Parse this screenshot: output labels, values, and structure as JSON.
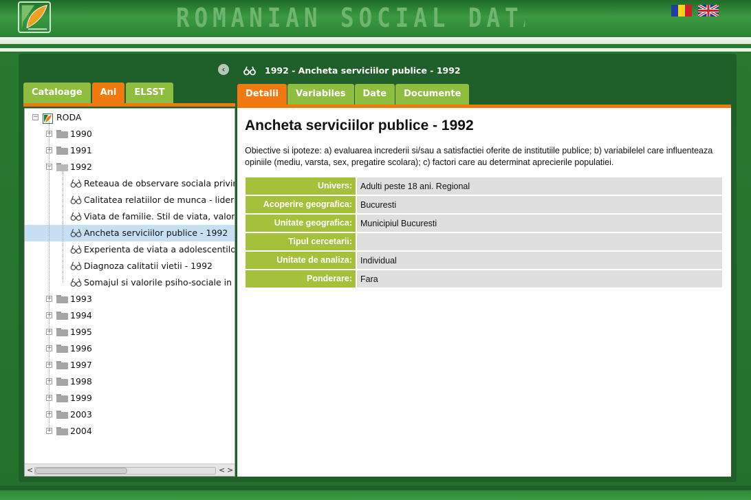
{
  "banner": {
    "title": "ROMANIAN SOCIAL DATA ARCHIVE",
    "logo_icon": "roda-logo-icon",
    "flags": [
      "romanian-flag-icon",
      "uk-flag-icon"
    ]
  },
  "left_panel": {
    "tabs": [
      {
        "label": "Cataloage",
        "active": false
      },
      {
        "label": "Ani",
        "active": true
      },
      {
        "label": "ELSST",
        "active": false
      }
    ],
    "tree": {
      "root": "RODA",
      "years_before": [
        "1990",
        "1991"
      ],
      "open_year": "1992",
      "studies": [
        "Reteaua de observare sociala privind",
        "Calitatea relatiilor de munca - lideri sir",
        "Viata de familie. Stil de viata, valori fa",
        "Ancheta serviciilor publice - 1992",
        "Experienta de viata a adolescentilor -",
        "Diagnoza calitatii vietii - 1992",
        "Somajul si valorile psiho-sociale in oc"
      ],
      "selected_study": "Ancheta serviciilor publice - 1992",
      "years_after": [
        "1993",
        "1994",
        "1995",
        "1996",
        "1997",
        "1998",
        "1999",
        "2003",
        "2004"
      ]
    }
  },
  "right_panel": {
    "title": "1992 - Ancheta serviciilor publice - 1992",
    "tabs": [
      {
        "label": "Detalii",
        "active": true
      },
      {
        "label": "Variabiles",
        "active": false
      },
      {
        "label": "Date",
        "active": false
      },
      {
        "label": "Documente",
        "active": false
      }
    ],
    "heading": "Ancheta serviciilor publice - 1992",
    "objective": "Obiective si ipoteze: a) evaluarea increderii si/sau a satisfactiei oferite de institutiile publice; b) variabilelel care influenteaza opiniile (mediu, varsta, sex, pregatire scolara); c) factori care au determinat aprecierile populatiei.",
    "properties": [
      {
        "label": "Univers:",
        "value": "Adulti peste 18 ani. Regional"
      },
      {
        "label": "Acoperire geografica:",
        "value": "Bucuresti"
      },
      {
        "label": "Unitate geografica:",
        "value": "Municipiul Bucuresti"
      },
      {
        "label": "Tipul cercetarii:",
        "value": ""
      },
      {
        "label": "Unitate de analiza:",
        "value": "Individual"
      },
      {
        "label": "Ponderare:",
        "value": "Fara"
      }
    ]
  },
  "colors": {
    "brand_green": "#1e5f2a",
    "tab_green": "#8fbd3f",
    "tab_active_orange": "#f07a10",
    "label_green": "#a3c13b",
    "selected_blue": "#c6dff3"
  }
}
